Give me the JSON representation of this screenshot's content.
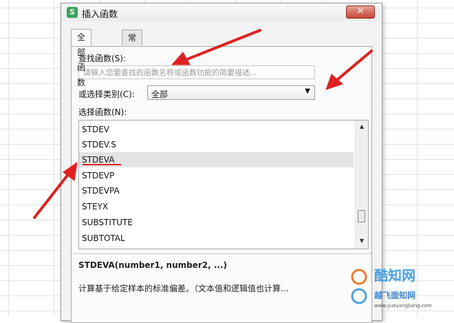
{
  "dialog": {
    "title": "插入函数",
    "app_icon_letter": "S",
    "close_glyph": "✕",
    "tabs": [
      {
        "label": "全部函数",
        "active": true
      },
      {
        "label": "常用公式",
        "active": false
      }
    ],
    "search": {
      "label": "查找函数(S):",
      "placeholder": "请输入您要查找的函数名称或函数功能的简要描述..."
    },
    "category": {
      "label": "或选择类别(C):",
      "value": "全部"
    },
    "functions": {
      "label": "选择函数(N):",
      "items": [
        "STDEV",
        "STDEV.S",
        "STDEVA",
        "STDEVP",
        "STDEVPA",
        "STEYX",
        "SUBSTITUTE",
        "SUBTOTAL"
      ],
      "selected": "STDEVA"
    },
    "syntax": "STDEVA(number1, number2, ...)",
    "description": "计算基于给定样本的标准偏差。（文本值和逻辑值也计算..."
  },
  "watermark": {
    "main": "酷知网",
    "sub": "越飞面知网",
    "url": "www.yueyangbang.com"
  },
  "colors": {
    "annotation": "#e02020",
    "accent": "#3aa35a"
  }
}
